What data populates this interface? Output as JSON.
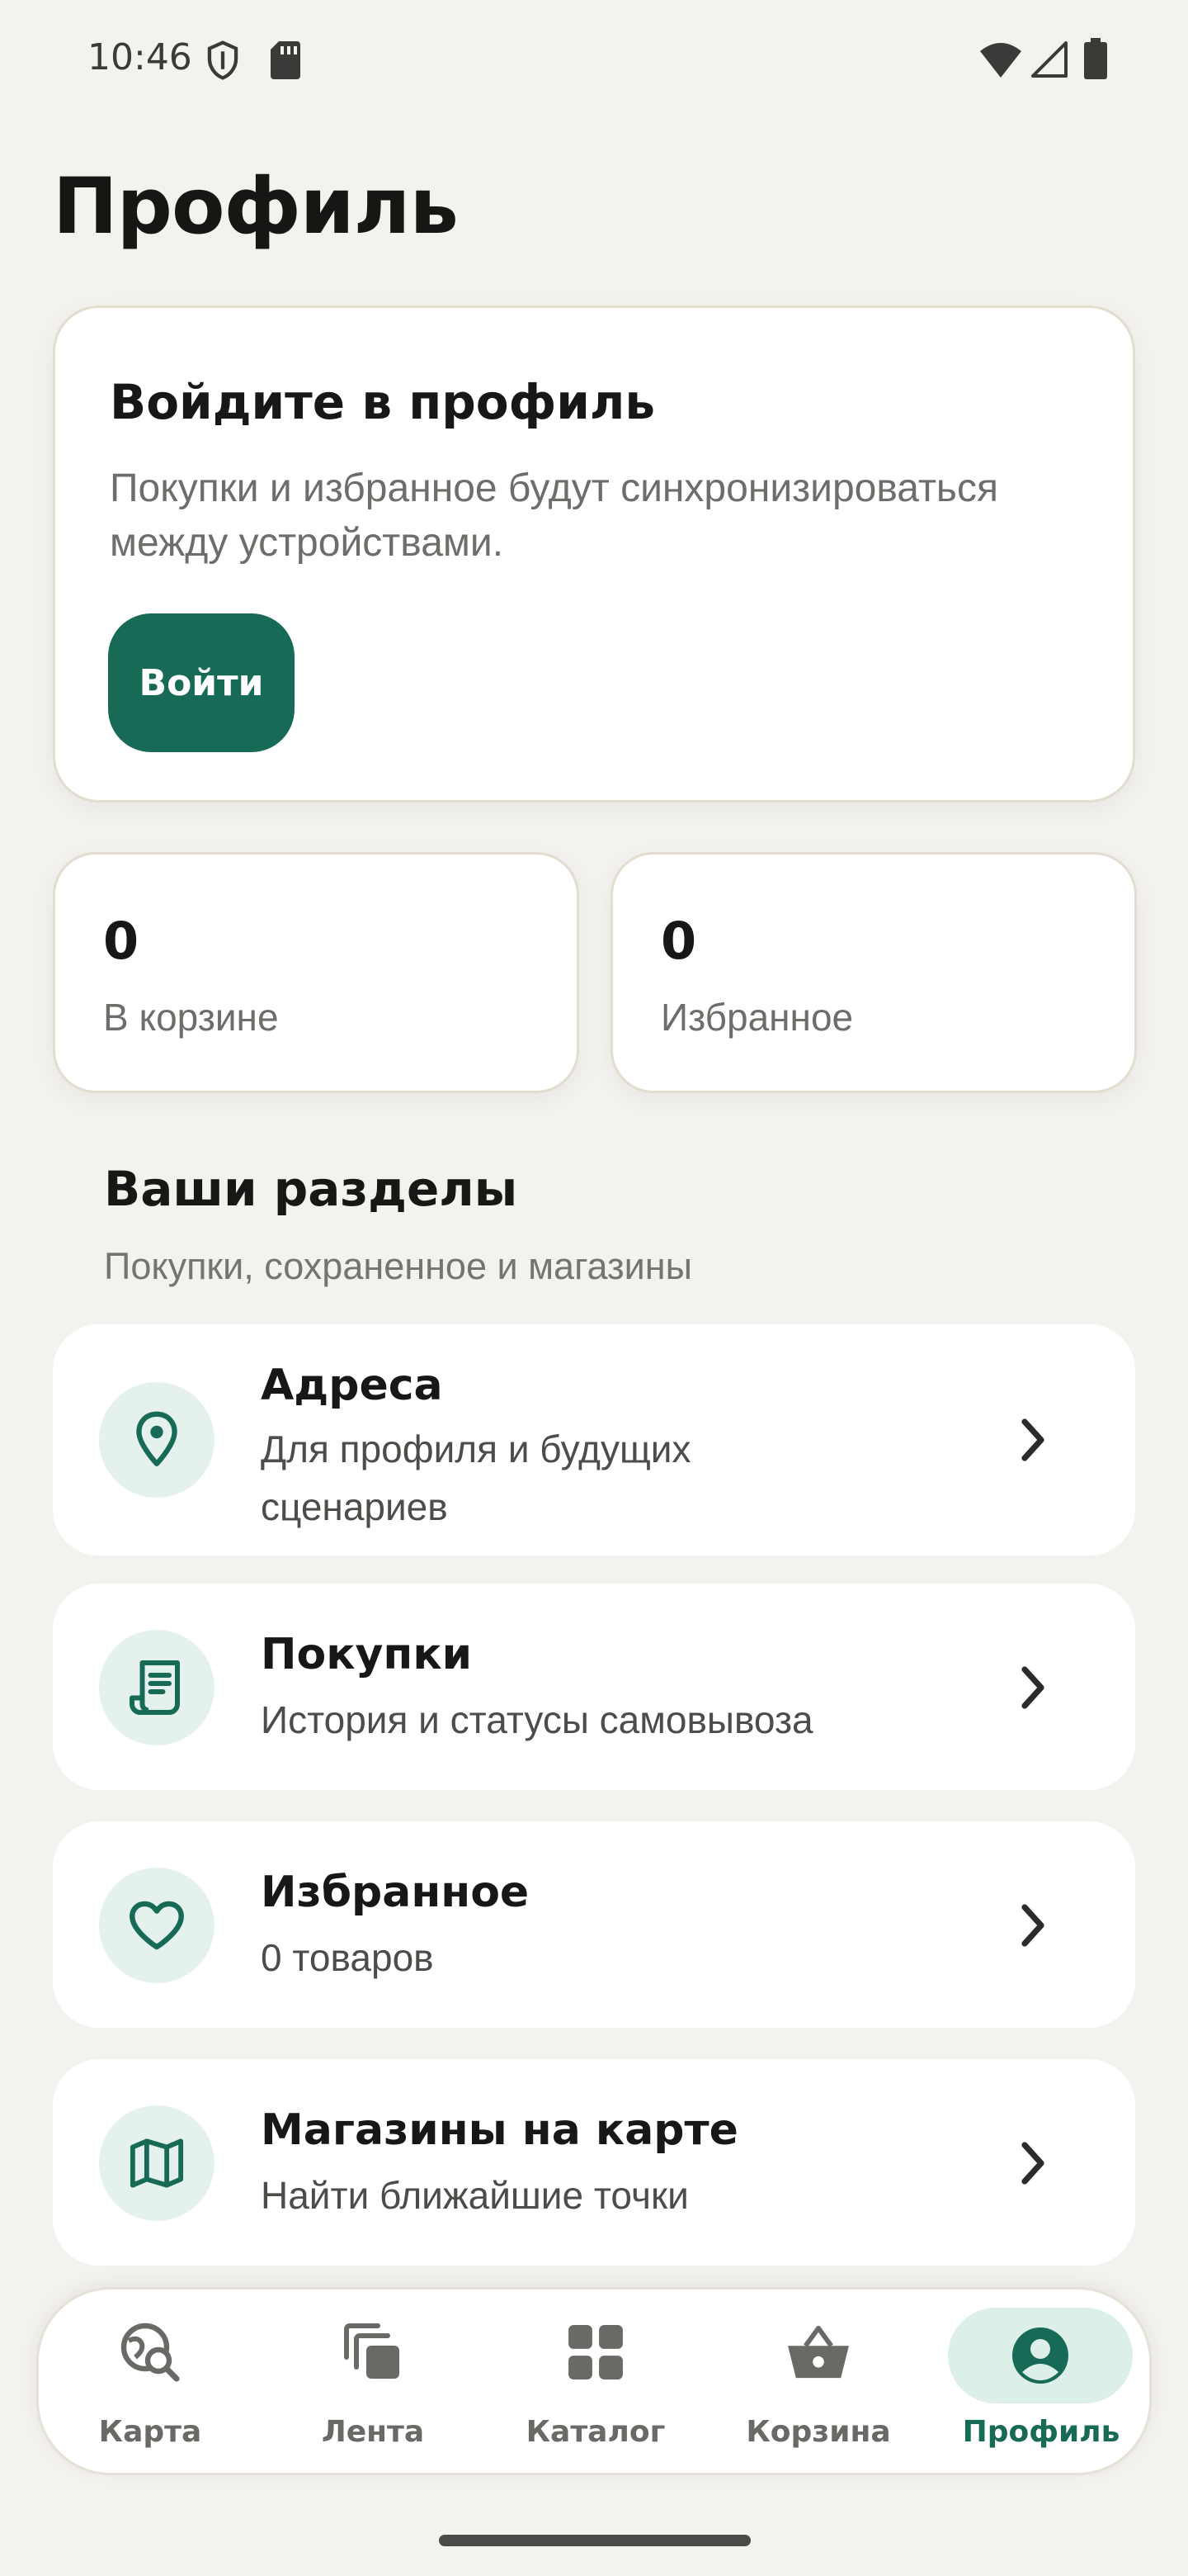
{
  "status_bar": {
    "time": "10:46",
    "icons": [
      "shield-icon",
      "sd-card-icon",
      "wifi-icon",
      "cellular-signal-icon",
      "battery-icon"
    ]
  },
  "page_title": "Профиль",
  "login_card": {
    "title": "Войдите в профиль",
    "description": "Покупки и избранное будут синхронизироваться между устройствами.",
    "button_label": "Войти"
  },
  "stats": {
    "cart": {
      "value": "0",
      "label": "В корзине"
    },
    "favorites": {
      "value": "0",
      "label": "Избранное"
    }
  },
  "section": {
    "title": "Ваши разделы",
    "subtitle": "Покупки, сохраненное и магазины"
  },
  "items": [
    {
      "icon": "location-pin-icon",
      "title": "Адреса",
      "subtitle": "Для профиля и будущих сценариев"
    },
    {
      "icon": "receipt-icon",
      "title": "Покупки",
      "subtitle": "История и статусы самовывоза"
    },
    {
      "icon": "heart-icon",
      "title": "Избранное",
      "subtitle": "0 товаров"
    },
    {
      "icon": "map-icon",
      "title": "Магазины на карте",
      "subtitle": "Найти ближайшие точки"
    }
  ],
  "bottom_nav": [
    {
      "icon": "map-search-icon",
      "label": "Карта"
    },
    {
      "icon": "feed-icon",
      "label": "Лента"
    },
    {
      "icon": "grid-icon",
      "label": "Каталог"
    },
    {
      "icon": "basket-icon",
      "label": "Корзина"
    },
    {
      "icon": "profile-icon",
      "label": "Профиль",
      "active": true
    }
  ],
  "colors": {
    "background": "#f3f2ee",
    "accent": "#176b56",
    "accent_light": "#e4f1ec",
    "card": "#ffffff"
  }
}
